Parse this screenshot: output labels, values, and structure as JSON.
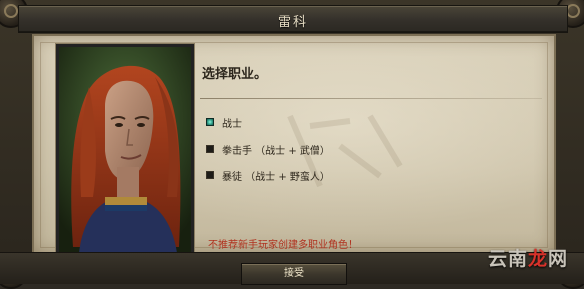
{
  "dialog": {
    "title": "雷科",
    "prompt": "选择职业。",
    "classes": [
      {
        "label": "战士",
        "selected": true
      },
      {
        "label": "拳击手 （战士 + 武僧）",
        "selected": false
      },
      {
        "label": "暴徒 （战士 + 野蛮人）",
        "selected": false
      }
    ],
    "warning": "不推荐新手玩家创建多职业角色！",
    "accept_label": "接受"
  },
  "watermark": {
    "brand": "云南",
    "accent": "龙",
    "tail": "网"
  },
  "colors": {
    "parchment": "#d9d0b9",
    "frame": "#2e2a24",
    "warning": "#b0321f",
    "selected_box": "#2f9f8a"
  }
}
